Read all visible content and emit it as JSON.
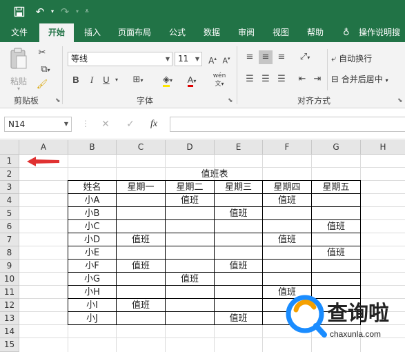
{
  "quick_access": {
    "save_icon": "save-icon",
    "undo_icon": "undo-icon",
    "redo_icon": "redo-icon",
    "customize_icon": "customize-qat-icon"
  },
  "tabs": [
    {
      "label": "文件"
    },
    {
      "label": "开始"
    },
    {
      "label": "插入"
    },
    {
      "label": "页面布局"
    },
    {
      "label": "公式"
    },
    {
      "label": "数据"
    },
    {
      "label": "审阅"
    },
    {
      "label": "视图"
    },
    {
      "label": "帮助"
    },
    {
      "label": "操作说明搜"
    }
  ],
  "ribbon": {
    "clipboard": {
      "paste_label": "粘贴",
      "group_label": "剪贴板"
    },
    "font": {
      "font_name": "等线",
      "font_size": "11",
      "group_label": "字体",
      "bold": "B",
      "italic": "I",
      "underline": "U",
      "font_color_letter": "A",
      "pinyin": "wén"
    },
    "alignment": {
      "wrap_text": "自动换行",
      "merge_center": "合并后居中",
      "group_label": "对齐方式"
    }
  },
  "formula_bar": {
    "name_box": "N14",
    "cancel": "✕",
    "enter": "✓",
    "fx": "fx",
    "formula": ""
  },
  "sheet": {
    "columns": [
      "A",
      "B",
      "C",
      "D",
      "E",
      "F",
      "G",
      "H"
    ],
    "rows": [
      "1",
      "2",
      "3",
      "4",
      "5",
      "6",
      "7",
      "8",
      "9",
      "10",
      "11",
      "12",
      "13",
      "14",
      "15"
    ],
    "title": "值班表",
    "header": [
      "姓名",
      "星期一",
      "星期二",
      "星期三",
      "星期四",
      "星期五"
    ],
    "body": [
      [
        "小A",
        "",
        "值班",
        "",
        "值班",
        ""
      ],
      [
        "小B",
        "",
        "",
        "值班",
        "",
        ""
      ],
      [
        "小C",
        "",
        "",
        "",
        "",
        "值班"
      ],
      [
        "小D",
        "值班",
        "",
        "",
        "值班",
        ""
      ],
      [
        "小E",
        "",
        "",
        "",
        "",
        "值班"
      ],
      [
        "小F",
        "值班",
        "",
        "值班",
        "",
        ""
      ],
      [
        "小G",
        "",
        "值班",
        "",
        "",
        ""
      ],
      [
        "小H",
        "",
        "",
        "",
        "值班",
        ""
      ],
      [
        "小I",
        "值班",
        "",
        "",
        "",
        ""
      ],
      [
        "小J",
        "",
        "",
        "值班",
        "",
        ""
      ]
    ],
    "arrow_color": "#e03131"
  },
  "watermark": {
    "brand": "查询啦",
    "site": "chaxunla.com"
  },
  "colors": {
    "accent": "#217346"
  }
}
